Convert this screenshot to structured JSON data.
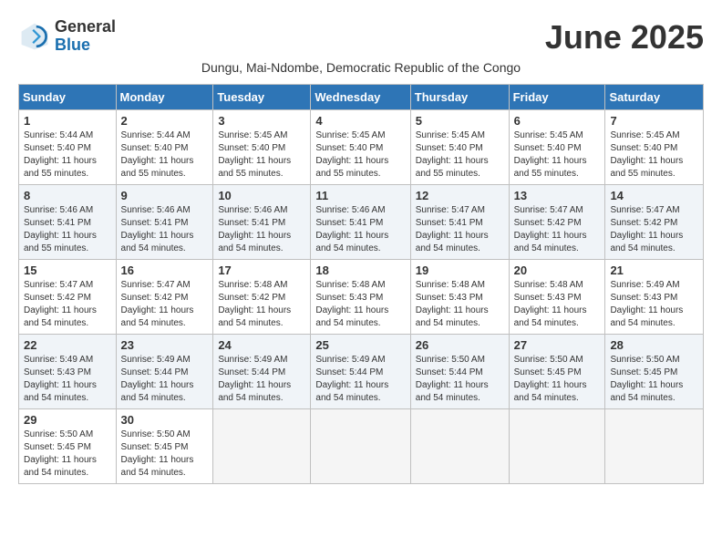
{
  "logo": {
    "line1": "General",
    "line2": "Blue"
  },
  "title": "June 2025",
  "subtitle": "Dungu, Mai-Ndombe, Democratic Republic of the Congo",
  "headers": [
    "Sunday",
    "Monday",
    "Tuesday",
    "Wednesday",
    "Thursday",
    "Friday",
    "Saturday"
  ],
  "weeks": [
    [
      {
        "day": "1",
        "sunrise": "Sunrise: 5:44 AM",
        "sunset": "Sunset: 5:40 PM",
        "daylight": "Daylight: 11 hours and 55 minutes."
      },
      {
        "day": "2",
        "sunrise": "Sunrise: 5:44 AM",
        "sunset": "Sunset: 5:40 PM",
        "daylight": "Daylight: 11 hours and 55 minutes."
      },
      {
        "day": "3",
        "sunrise": "Sunrise: 5:45 AM",
        "sunset": "Sunset: 5:40 PM",
        "daylight": "Daylight: 11 hours and 55 minutes."
      },
      {
        "day": "4",
        "sunrise": "Sunrise: 5:45 AM",
        "sunset": "Sunset: 5:40 PM",
        "daylight": "Daylight: 11 hours and 55 minutes."
      },
      {
        "day": "5",
        "sunrise": "Sunrise: 5:45 AM",
        "sunset": "Sunset: 5:40 PM",
        "daylight": "Daylight: 11 hours and 55 minutes."
      },
      {
        "day": "6",
        "sunrise": "Sunrise: 5:45 AM",
        "sunset": "Sunset: 5:40 PM",
        "daylight": "Daylight: 11 hours and 55 minutes."
      },
      {
        "day": "7",
        "sunrise": "Sunrise: 5:45 AM",
        "sunset": "Sunset: 5:40 PM",
        "daylight": "Daylight: 11 hours and 55 minutes."
      }
    ],
    [
      {
        "day": "8",
        "sunrise": "Sunrise: 5:46 AM",
        "sunset": "Sunset: 5:41 PM",
        "daylight": "Daylight: 11 hours and 55 minutes."
      },
      {
        "day": "9",
        "sunrise": "Sunrise: 5:46 AM",
        "sunset": "Sunset: 5:41 PM",
        "daylight": "Daylight: 11 hours and 54 minutes."
      },
      {
        "day": "10",
        "sunrise": "Sunrise: 5:46 AM",
        "sunset": "Sunset: 5:41 PM",
        "daylight": "Daylight: 11 hours and 54 minutes."
      },
      {
        "day": "11",
        "sunrise": "Sunrise: 5:46 AM",
        "sunset": "Sunset: 5:41 PM",
        "daylight": "Daylight: 11 hours and 54 minutes."
      },
      {
        "day": "12",
        "sunrise": "Sunrise: 5:47 AM",
        "sunset": "Sunset: 5:41 PM",
        "daylight": "Daylight: 11 hours and 54 minutes."
      },
      {
        "day": "13",
        "sunrise": "Sunrise: 5:47 AM",
        "sunset": "Sunset: 5:42 PM",
        "daylight": "Daylight: 11 hours and 54 minutes."
      },
      {
        "day": "14",
        "sunrise": "Sunrise: 5:47 AM",
        "sunset": "Sunset: 5:42 PM",
        "daylight": "Daylight: 11 hours and 54 minutes."
      }
    ],
    [
      {
        "day": "15",
        "sunrise": "Sunrise: 5:47 AM",
        "sunset": "Sunset: 5:42 PM",
        "daylight": "Daylight: 11 hours and 54 minutes."
      },
      {
        "day": "16",
        "sunrise": "Sunrise: 5:47 AM",
        "sunset": "Sunset: 5:42 PM",
        "daylight": "Daylight: 11 hours and 54 minutes."
      },
      {
        "day": "17",
        "sunrise": "Sunrise: 5:48 AM",
        "sunset": "Sunset: 5:42 PM",
        "daylight": "Daylight: 11 hours and 54 minutes."
      },
      {
        "day": "18",
        "sunrise": "Sunrise: 5:48 AM",
        "sunset": "Sunset: 5:43 PM",
        "daylight": "Daylight: 11 hours and 54 minutes."
      },
      {
        "day": "19",
        "sunrise": "Sunrise: 5:48 AM",
        "sunset": "Sunset: 5:43 PM",
        "daylight": "Daylight: 11 hours and 54 minutes."
      },
      {
        "day": "20",
        "sunrise": "Sunrise: 5:48 AM",
        "sunset": "Sunset: 5:43 PM",
        "daylight": "Daylight: 11 hours and 54 minutes."
      },
      {
        "day": "21",
        "sunrise": "Sunrise: 5:49 AM",
        "sunset": "Sunset: 5:43 PM",
        "daylight": "Daylight: 11 hours and 54 minutes."
      }
    ],
    [
      {
        "day": "22",
        "sunrise": "Sunrise: 5:49 AM",
        "sunset": "Sunset: 5:43 PM",
        "daylight": "Daylight: 11 hours and 54 minutes."
      },
      {
        "day": "23",
        "sunrise": "Sunrise: 5:49 AM",
        "sunset": "Sunset: 5:44 PM",
        "daylight": "Daylight: 11 hours and 54 minutes."
      },
      {
        "day": "24",
        "sunrise": "Sunrise: 5:49 AM",
        "sunset": "Sunset: 5:44 PM",
        "daylight": "Daylight: 11 hours and 54 minutes."
      },
      {
        "day": "25",
        "sunrise": "Sunrise: 5:49 AM",
        "sunset": "Sunset: 5:44 PM",
        "daylight": "Daylight: 11 hours and 54 minutes."
      },
      {
        "day": "26",
        "sunrise": "Sunrise: 5:50 AM",
        "sunset": "Sunset: 5:44 PM",
        "daylight": "Daylight: 11 hours and 54 minutes."
      },
      {
        "day": "27",
        "sunrise": "Sunrise: 5:50 AM",
        "sunset": "Sunset: 5:45 PM",
        "daylight": "Daylight: 11 hours and 54 minutes."
      },
      {
        "day": "28",
        "sunrise": "Sunrise: 5:50 AM",
        "sunset": "Sunset: 5:45 PM",
        "daylight": "Daylight: 11 hours and 54 minutes."
      }
    ],
    [
      {
        "day": "29",
        "sunrise": "Sunrise: 5:50 AM",
        "sunset": "Sunset: 5:45 PM",
        "daylight": "Daylight: 11 hours and 54 minutes."
      },
      {
        "day": "30",
        "sunrise": "Sunrise: 5:50 AM",
        "sunset": "Sunset: 5:45 PM",
        "daylight": "Daylight: 11 hours and 54 minutes."
      },
      null,
      null,
      null,
      null,
      null
    ]
  ]
}
